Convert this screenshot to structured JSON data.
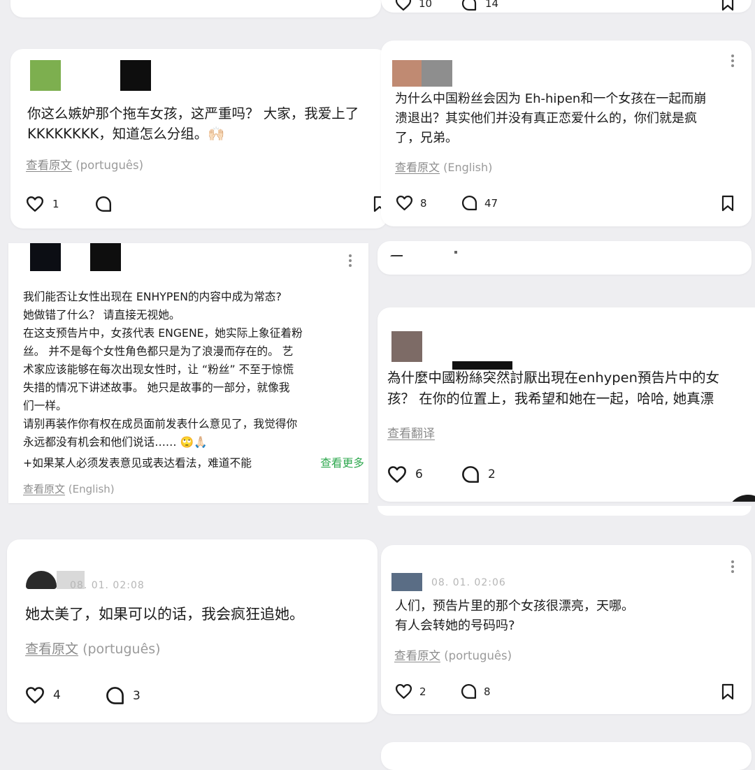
{
  "comments": [
    {
      "id": "c1",
      "body": "你这么嫉妒那个拖车女孩，这严重吗？ 大家，我爱上了\nKKKKKKKK，知道怎么分组。🙌🏻",
      "view_original": "查看原文",
      "language": "(português)",
      "likes": "1",
      "replies": ""
    },
    {
      "id": "c2",
      "body": "为什么中国粉丝会因为 Eh-hipen和一个女孩在一起而崩\n溃退出？其实他们并没有真正恋爱什么的，你们就是疯\n了，兄弟。",
      "view_original": "查看原文",
      "language": "(English)",
      "likes": "8",
      "replies": "47"
    },
    {
      "id": "c3",
      "body": "我们能否让女性出现在 ENHYPEN的内容中成为常态?\n她做错了什么？ 请直接无视她。\n在这支预告片中，女孩代表 ENGENE，她实际上象征着粉\n丝。 并不是每个女性角色都只是为了浪漫而存在的。 艺\n术家应该能够在每次出现女性时，让 “粉丝” 不至于惊慌\n失措的情况下讲述故事。 她只是故事的一部分，就像我\n们一样。\n请别再装作你有权在成员面前发表什么意见了，我觉得你\n永远都没有机会和他们说话…… 🙄🙏🏻",
      "last_line": "+如果某人必须发表意见或表达看法，难道不能",
      "see_more": "查看更多",
      "view_original": "查看原文",
      "language": "(English)"
    },
    {
      "id": "c4",
      "body": "為什麼中國粉絲突然討厭出現在enhypen預告片中的女\n孩？ 在你的位置上，我希望和她在一起，哈哈, 她真漂",
      "view_translation": "查看翻译",
      "likes": "6",
      "replies": "2"
    },
    {
      "id": "c5",
      "timestamp": "08. 01. 02:08",
      "body": "她太美了，如果可以的话，我会疯狂追她。",
      "view_original": "查看原文",
      "language": "(português)",
      "likes": "4",
      "replies": "3"
    },
    {
      "id": "c6",
      "timestamp": "08. 01. 02:06",
      "body": "人们，预告片里的那个女孩很漂亮，天哪。\n有人会转她的号码吗?",
      "view_original": "查看原文",
      "language": "(português)",
      "likes": "2",
      "replies": "8"
    }
  ],
  "top_cutoff": {
    "likes": "10",
    "replies": "14"
  },
  "icons": {
    "like": "heart-outline-icon",
    "reply": "speech-bubble-icon",
    "bookmark": "bookmark-icon",
    "more": "more-vertical-icon"
  },
  "colors": {
    "background": "#eeeef1",
    "card": "#ffffff",
    "link_gray": "#8a8a8a",
    "see_more_green": "#2fa84f"
  }
}
